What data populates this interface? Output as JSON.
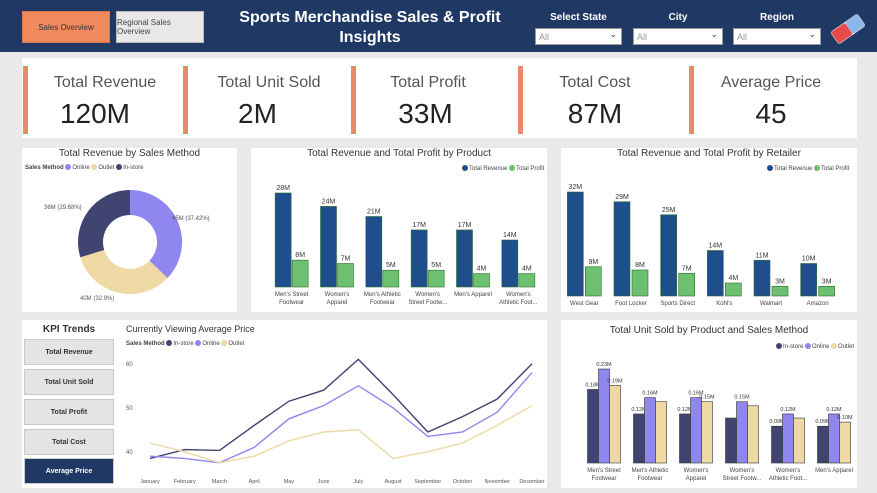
{
  "nav": {
    "sales_overview": "Sales Overview",
    "regional_overview": "Regional Sales Overview"
  },
  "title": "Sports Merchandise Sales & Profit Insights",
  "filters": [
    {
      "label": "Select State",
      "value": "All"
    },
    {
      "label": "City",
      "value": "All"
    },
    {
      "label": "Region",
      "value": "All"
    }
  ],
  "colors": {
    "header": "#1f3864",
    "accent": "#f08a5d",
    "revenue": "#1f4e8c",
    "profit": "#6cc070",
    "instore": "#3f4570",
    "online": "#8f86ef",
    "outlet": "#eed9a4"
  },
  "kpis": [
    {
      "label": "Total Revenue",
      "value": "120M"
    },
    {
      "label": "Total Unit Sold",
      "value": "2M"
    },
    {
      "label": "Total Profit",
      "value": "33M"
    },
    {
      "label": "Total Cost",
      "value": "87M"
    },
    {
      "label": "Average Price",
      "value": "45"
    }
  ],
  "kpi_trends": {
    "title": "KPI Trends",
    "buttons": [
      "Total Revenue",
      "Total Unit Sold",
      "Total Profit",
      "Total Cost",
      "Average Price"
    ],
    "active": "Average Price"
  },
  "chart_data": [
    {
      "type": "pie",
      "title": "Total Revenue by Sales Method",
      "legend_title": "Sales Method",
      "legend_items": [
        "Online",
        "Outlet",
        "In-store"
      ],
      "slices": [
        {
          "name": "Online",
          "value": 45,
          "label": "45M (37.42%)",
          "color": "#8f86ef"
        },
        {
          "name": "Outlet",
          "value": 40,
          "label": "40M (32.9%)",
          "color": "#eed9a4"
        },
        {
          "name": "In-store",
          "value": 36,
          "label": "36M (29.68%)",
          "color": "#3f4570"
        }
      ]
    },
    {
      "type": "bar",
      "title": "Total Revenue and Total Profit by Product",
      "legend_items": [
        "Total Revenue",
        "Total Profit"
      ],
      "categories": [
        [
          "Men's Street",
          "Footwear"
        ],
        [
          "Women's",
          "Apparel"
        ],
        [
          "Men's Athletic",
          "Footwear"
        ],
        [
          "Women's",
          "Street Footw..."
        ],
        [
          "Men's Apparel"
        ],
        [
          "Women's",
          "Athletic Foot..."
        ]
      ],
      "series": [
        {
          "name": "Total Revenue",
          "values": [
            28,
            24,
            21,
            17,
            17,
            14
          ],
          "labels": [
            "28M",
            "24M",
            "21M",
            "17M",
            "17M",
            "14M"
          ]
        },
        {
          "name": "Total Profit",
          "values": [
            8,
            7,
            5,
            5,
            4,
            4
          ],
          "labels": [
            "8M",
            "7M",
            "5M",
            "5M",
            "4M",
            "4M"
          ]
        }
      ]
    },
    {
      "type": "bar",
      "title": "Total Revenue and Total Profit by Retailer",
      "legend_items": [
        "Total Revenue",
        "Total Profit"
      ],
      "categories": [
        [
          "West Gear"
        ],
        [
          "Foot Locker"
        ],
        [
          "Sports Direct"
        ],
        [
          "Kohl's"
        ],
        [
          "Walmart"
        ],
        [
          "Amazon"
        ]
      ],
      "series": [
        {
          "name": "Total Revenue",
          "values": [
            32,
            29,
            25,
            14,
            11,
            10
          ],
          "labels": [
            "32M",
            "29M",
            "25M",
            "14M",
            "11M",
            "10M"
          ]
        },
        {
          "name": "Total Profit",
          "values": [
            9,
            8,
            7,
            4,
            3,
            3
          ],
          "labels": [
            "9M",
            "8M",
            "7M",
            "4M",
            "3M",
            "3M"
          ]
        }
      ]
    },
    {
      "type": "line",
      "title": "Currently Viewing Average Price",
      "legend_title": "Sales Method",
      "legend_items": [
        "In-store",
        "Online",
        "Outlet"
      ],
      "x": [
        "January",
        "February",
        "March",
        "April",
        "May",
        "June",
        "July",
        "August",
        "September",
        "October",
        "November",
        "December"
      ],
      "y_ticks": [
        "60",
        "50",
        "40"
      ],
      "ylim": [
        37,
        62
      ],
      "series": [
        {
          "name": "In-store",
          "values": [
            38.5,
            40.5,
            40.3,
            46,
            51.5,
            54,
            61,
            53,
            44.5,
            48,
            52,
            60
          ]
        },
        {
          "name": "Online",
          "values": [
            39,
            38.5,
            37.5,
            41,
            47.5,
            50.5,
            55,
            50,
            43.5,
            44.5,
            49,
            58
          ]
        },
        {
          "name": "Outlet",
          "values": [
            42,
            40,
            37.5,
            39,
            42.5,
            44.5,
            45,
            38.5,
            40,
            42,
            46,
            50.5
          ]
        }
      ]
    },
    {
      "type": "bar",
      "title": "Total Unit Sold by Product and Sales Method",
      "legend_items": [
        "In-store",
        "Online",
        "Outlet"
      ],
      "categories": [
        [
          "Men's Street",
          "Footwear"
        ],
        [
          "Men's Athletic",
          "Footwear"
        ],
        [
          "Women's",
          "Apparel"
        ],
        [
          "Women's",
          "Street Footw..."
        ],
        [
          "Women's",
          "Athletic Foot..."
        ],
        [
          "Men's Apparel"
        ]
      ],
      "series": [
        {
          "name": "In-store",
          "values": [
            0.18,
            0.12,
            0.12,
            0.11,
            0.09,
            0.09
          ],
          "labels": [
            "0.18M",
            "0.12M",
            "0.12M",
            "",
            "0.09M",
            "0.09M"
          ]
        },
        {
          "name": "Online",
          "values": [
            0.23,
            0.16,
            0.16,
            0.15,
            0.12,
            0.12
          ],
          "labels": [
            "0.23M",
            "0.16M",
            "0.16M",
            "0.15M",
            "0.12M",
            "0.12M"
          ]
        },
        {
          "name": "Outlet",
          "values": [
            0.19,
            0.15,
            0.15,
            0.14,
            0.11,
            0.1
          ],
          "labels": [
            "0.19M",
            "",
            "0.15M",
            "",
            "",
            "0.10M"
          ]
        }
      ]
    }
  ]
}
